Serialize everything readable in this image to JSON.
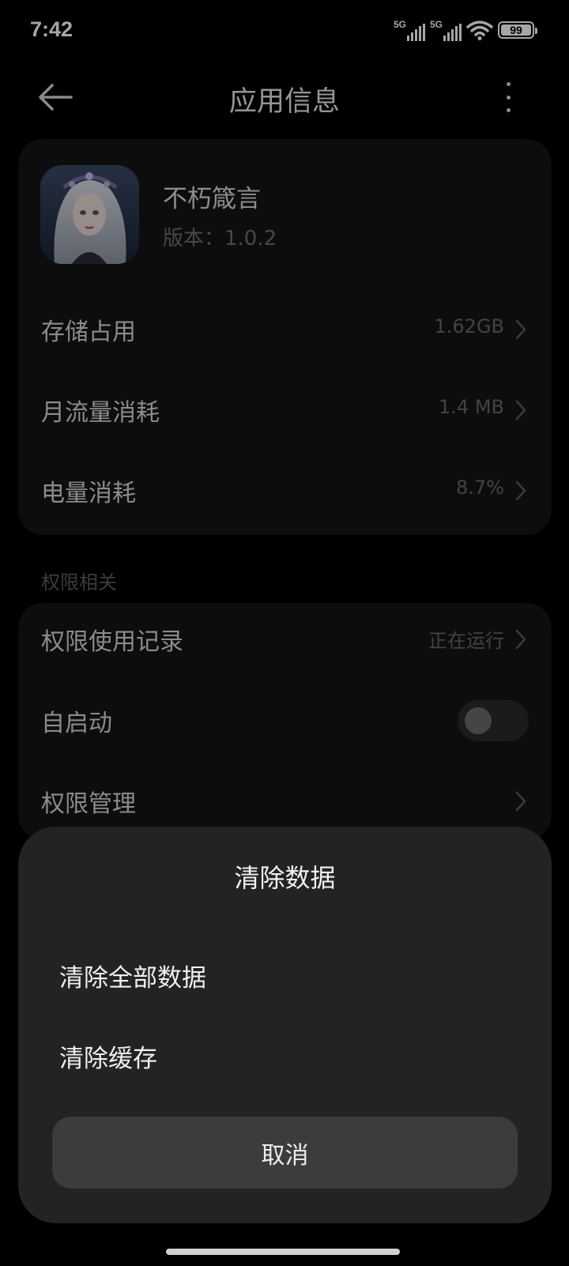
{
  "status_bar": {
    "time": "7:42",
    "signal_1": "5G",
    "signal_2": "5G",
    "battery_level": "99",
    "battery_fraction": 0.99
  },
  "header": {
    "title": "应用信息",
    "back_icon": "arrow-left-icon",
    "more_icon": "more-vertical-icon"
  },
  "app": {
    "name": "不朽箴言",
    "version": "版本：1.0.2",
    "icon": "app-icon-portrait"
  },
  "usage_rows": [
    {
      "label": "存储占用",
      "value": "1.62GB"
    },
    {
      "label": "月流量消耗",
      "value": "1.4 MB"
    },
    {
      "label": "电量消耗",
      "value": "8.7%"
    }
  ],
  "permissions": {
    "section_label": "权限相关",
    "rows": [
      {
        "label": "权限使用记录",
        "value": "正在运行"
      },
      {
        "label": "自启动",
        "toggle_on": false
      },
      {
        "label": "权限管理",
        "value": ""
      }
    ]
  },
  "sheet": {
    "title": "清除数据",
    "items": [
      {
        "label": "清除全部数据"
      },
      {
        "label": "清除缓存"
      }
    ],
    "cancel_label": "取消"
  },
  "colors": {
    "background": "#000000",
    "card": "#141414",
    "sheet": "#232323",
    "cancel_button": "#3c3c3c"
  }
}
